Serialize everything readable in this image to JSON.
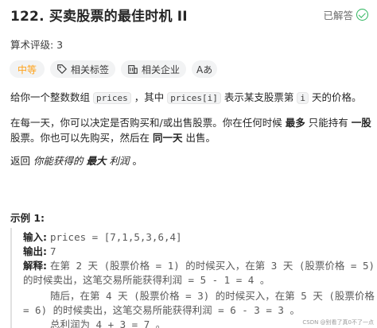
{
  "problem": {
    "title": "122. 买卖股票的最佳时机 II",
    "status": "已解答",
    "rating": "算术评级: 3"
  },
  "tags": {
    "difficulty": "中等",
    "related_topics": "相关标签",
    "related_companies": "相关企业",
    "font_toggle": "Aあ"
  },
  "description": {
    "p1_a": "给你一个整数数组",
    "p1_code1": "prices",
    "p1_b": "，其中",
    "p1_code2": "prices[i]",
    "p1_c": "表示某支股票第",
    "p1_code3": "i",
    "p1_d": "天的价格。",
    "p2_a": "在每一天，你可以决定是否购买和/或出售股票。你在任何时候",
    "p2_bold1": "最多",
    "p2_b": "只能持有",
    "p2_bold2": "一股",
    "p2_line2": "股票。你也可以先购买，然后在",
    "p2_bold3": "同一天",
    "p2_end": "出售。",
    "p3_a": "返回",
    "p3_italic": "你能获得的",
    "p3_bold": "最大",
    "p3_italic2": "利润",
    "p3_end": "。"
  },
  "example": {
    "title": "示例 1:",
    "input_label": "输入:",
    "input_value": "prices = [7,1,5,3,6,4]",
    "output_label": "输出:",
    "output_value": "7",
    "explain_label": "解释:",
    "explain_1": "在第 2 天 (股票价格 = 1) 的时候买入，在第 3 天 (股票价格 = 5)",
    "explain_2": "的时候卖出，这笔交易所能获得利润 = 5 - 1 = 4 。",
    "explain_3": "随后，在第 4 天 (股票价格 = 3) 的时候买入，在第 5 天 (股票价格",
    "explain_4": "= 6) 的时候卖出，这笔交易所能获得利润 = 6 - 3 = 3 。",
    "explain_5": "总利润为 4 + 3 = 7 。"
  },
  "watermark": "CSDN @别看了真0不了一点",
  "colors": {
    "difficulty": "#ffa116",
    "solved": "#2db55d",
    "tag_bg": "#f2f3f4"
  },
  "icons": [
    "check-circle-icon",
    "tag-icon",
    "building-icon",
    "font-size-icon"
  ]
}
